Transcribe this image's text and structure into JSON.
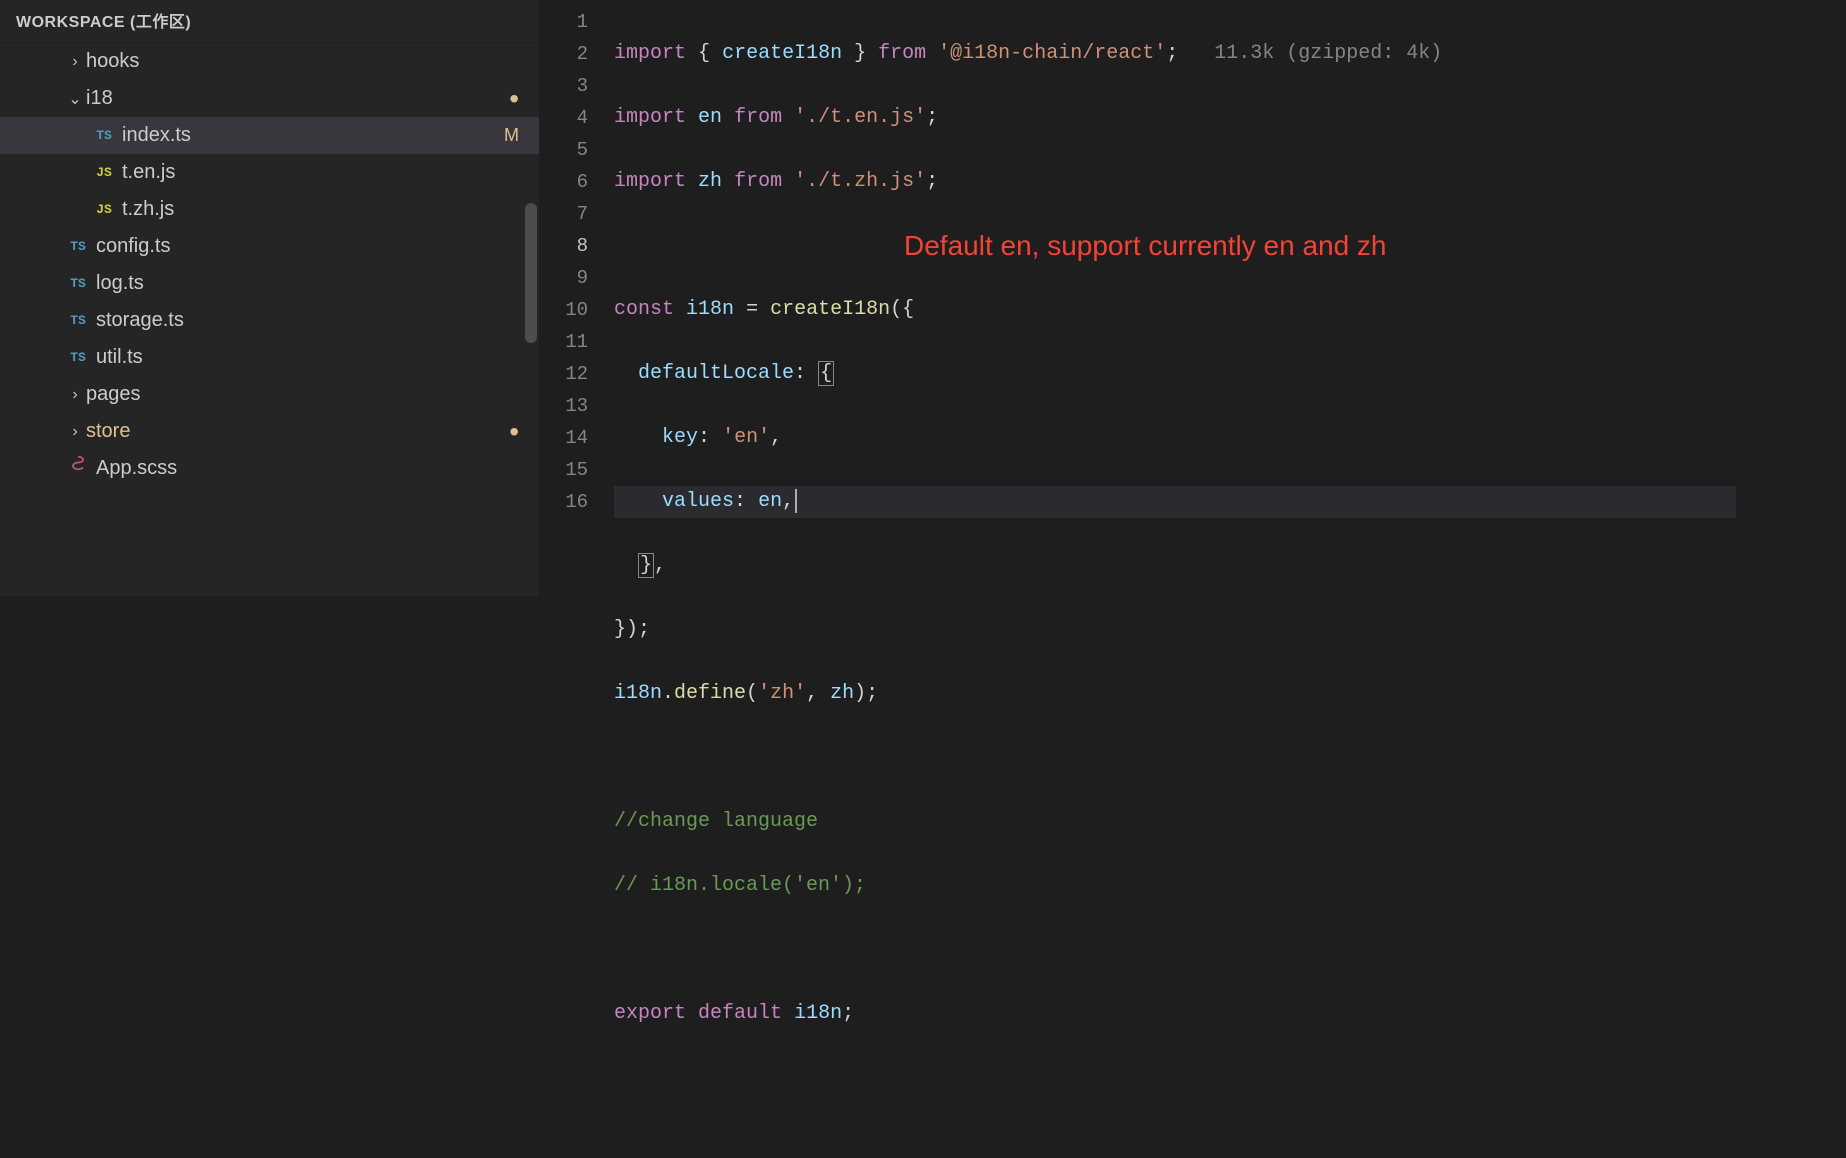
{
  "sidebar": {
    "header": "WORKSPACE (工作区)",
    "items": [
      {
        "type": "folder",
        "label": "hooks",
        "expanded": false,
        "indent": 1
      },
      {
        "type": "folder",
        "label": "i18",
        "expanded": true,
        "indent": 1,
        "badge": "dot"
      },
      {
        "type": "file",
        "label": "index.ts",
        "icon": "TS",
        "iconClass": "ts-icon",
        "indent": 2,
        "selected": true,
        "badge": "M"
      },
      {
        "type": "file",
        "label": "t.en.js",
        "icon": "JS",
        "iconClass": "js-icon",
        "indent": 2
      },
      {
        "type": "file",
        "label": "t.zh.js",
        "icon": "JS",
        "iconClass": "js-icon",
        "indent": 2
      },
      {
        "type": "file",
        "label": "config.ts",
        "icon": "TS",
        "iconClass": "ts-icon",
        "indent": 1
      },
      {
        "type": "file",
        "label": "log.ts",
        "icon": "TS",
        "iconClass": "ts-icon",
        "indent": 1
      },
      {
        "type": "file",
        "label": "storage.ts",
        "icon": "TS",
        "iconClass": "ts-icon",
        "indent": 1
      },
      {
        "type": "file",
        "label": "util.ts",
        "icon": "TS",
        "iconClass": "ts-icon",
        "indent": 1
      },
      {
        "type": "folder",
        "label": "pages",
        "expanded": false,
        "indent": 1
      },
      {
        "type": "folder",
        "label": "store",
        "expanded": false,
        "indent": 1,
        "highlight": true,
        "badge": "dot"
      },
      {
        "type": "file",
        "label": "App.scss",
        "icon": "scss",
        "iconClass": "scss-icon",
        "indent": 1
      }
    ]
  },
  "editor": {
    "lineNumbers": [
      "1",
      "2",
      "3",
      "4",
      "5",
      "6",
      "7",
      "8",
      "9",
      "10",
      "11",
      "12",
      "13",
      "14",
      "15",
      "16"
    ],
    "activeLine": 8,
    "sizeHint": "11.3k (gzipped: 4k)",
    "tokens": {
      "import": "import",
      "from": "from",
      "const": "const",
      "export": "export",
      "default": "default",
      "createI18n": "createI18n",
      "en": "en",
      "zh": "zh",
      "i18n": "i18n",
      "pkgReact": "'@i18n-chain/react'",
      "pathEn": "'./t.en.js'",
      "pathZh": "'./t.zh.js'",
      "defaultLocale": "defaultLocale",
      "key": "key",
      "enStr": "'en'",
      "values": "values",
      "define": "define",
      "zhStr": "'zh'",
      "cmtChange": "//change language",
      "cmtLocale": "// i18n.locale('en');"
    },
    "annotation": "Default en, support currently en and zh"
  }
}
